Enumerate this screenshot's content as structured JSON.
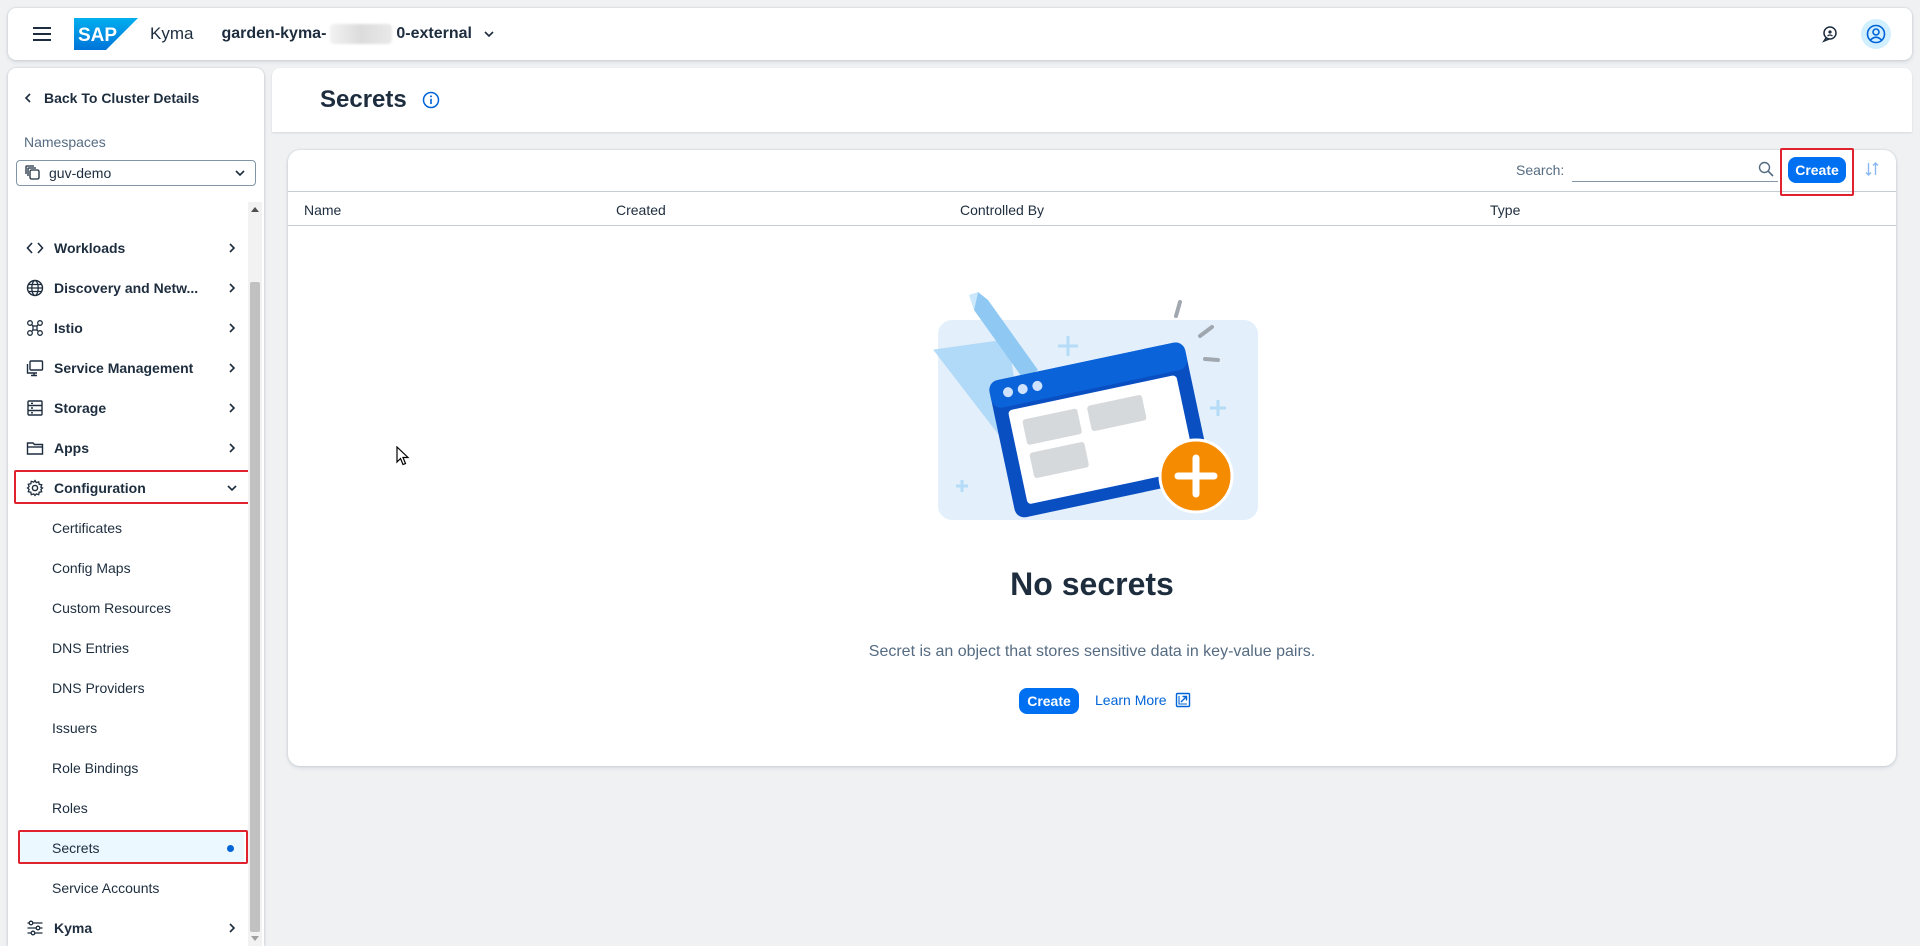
{
  "shellbar": {
    "product": "Kyma",
    "cluster_prefix": "garden-kyma-",
    "cluster_suffix": "0-external"
  },
  "sidebar": {
    "back_label": "Back To Cluster Details",
    "namespaces_label": "Namespaces",
    "namespace_value": "guv-demo",
    "items": [
      {
        "label": "Workloads",
        "icon": "code-icon"
      },
      {
        "label": "Discovery and Netw...",
        "icon": "globe-icon"
      },
      {
        "label": "Istio",
        "icon": "network-icon"
      },
      {
        "label": "Service Management",
        "icon": "monitor-icon"
      },
      {
        "label": "Storage",
        "icon": "storage-icon"
      },
      {
        "label": "Apps",
        "icon": "folder-icon"
      },
      {
        "label": "Configuration",
        "icon": "gear-icon"
      },
      {
        "label": "Kyma",
        "icon": "sliders-icon"
      }
    ],
    "sub_items": [
      {
        "label": "Certificates"
      },
      {
        "label": "Config Maps"
      },
      {
        "label": "Custom Resources"
      },
      {
        "label": "DNS Entries"
      },
      {
        "label": "DNS Providers"
      },
      {
        "label": "Issuers"
      },
      {
        "label": "Role Bindings"
      },
      {
        "label": "Roles"
      },
      {
        "label": "Secrets"
      },
      {
        "label": "Service Accounts"
      }
    ]
  },
  "main": {
    "title": "Secrets",
    "search_label": "Search:",
    "search_value": "",
    "create_label": "Create",
    "columns": [
      "Name",
      "Created",
      "Controlled By",
      "Type"
    ],
    "empty_title": "No secrets",
    "empty_desc": "Secret is an object that stores sensitive data in key-value pairs.",
    "empty_create_label": "Create",
    "learn_more_label": "Learn More"
  },
  "colors": {
    "accent": "#0070f2",
    "link": "#0064d9",
    "highlight": "#e0222f",
    "illustration_orange": "#f58b00"
  }
}
